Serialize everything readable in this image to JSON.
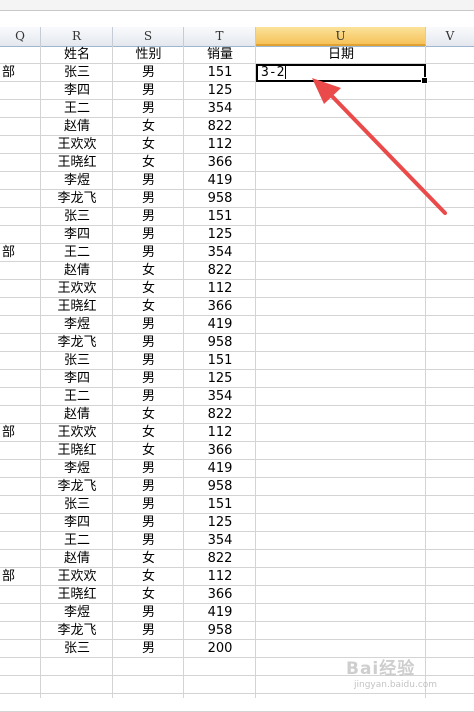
{
  "columns": [
    {
      "letter": "Q",
      "name": "col-q"
    },
    {
      "letter": "R",
      "name": "col-r"
    },
    {
      "letter": "S",
      "name": "col-s"
    },
    {
      "letter": "T",
      "name": "col-t"
    },
    {
      "letter": "U",
      "name": "col-u"
    },
    {
      "letter": "V",
      "name": "col-v"
    }
  ],
  "header_row": {
    "r": "姓名",
    "s": "性别",
    "t": "销量",
    "u": "日期"
  },
  "active_cell": {
    "column": "U",
    "input_text": "3-2"
  },
  "rows": [
    {
      "q": "部",
      "r": "张三",
      "s": "男",
      "t": "151"
    },
    {
      "q": "",
      "r": "李四",
      "s": "男",
      "t": "125"
    },
    {
      "q": "",
      "r": "王二",
      "s": "男",
      "t": "354"
    },
    {
      "q": "",
      "r": "赵倩",
      "s": "女",
      "t": "822"
    },
    {
      "q": "",
      "r": "王欢欢",
      "s": "女",
      "t": "112"
    },
    {
      "q": "",
      "r": "王晓红",
      "s": "女",
      "t": "366"
    },
    {
      "q": "",
      "r": "李煜",
      "s": "男",
      "t": "419"
    },
    {
      "q": "",
      "r": "李龙飞",
      "s": "男",
      "t": "958"
    },
    {
      "q": "",
      "r": "张三",
      "s": "男",
      "t": "151"
    },
    {
      "q": "",
      "r": "李四",
      "s": "男",
      "t": "125"
    },
    {
      "q": "部",
      "r": "王二",
      "s": "男",
      "t": "354"
    },
    {
      "q": "",
      "r": "赵倩",
      "s": "女",
      "t": "822"
    },
    {
      "q": "",
      "r": "王欢欢",
      "s": "女",
      "t": "112"
    },
    {
      "q": "",
      "r": "王晓红",
      "s": "女",
      "t": "366"
    },
    {
      "q": "",
      "r": "李煜",
      "s": "男",
      "t": "419"
    },
    {
      "q": "",
      "r": "李龙飞",
      "s": "男",
      "t": "958"
    },
    {
      "q": "",
      "r": "张三",
      "s": "男",
      "t": "151"
    },
    {
      "q": "",
      "r": "李四",
      "s": "男",
      "t": "125"
    },
    {
      "q": "",
      "r": "王二",
      "s": "男",
      "t": "354"
    },
    {
      "q": "",
      "r": "赵倩",
      "s": "女",
      "t": "822"
    },
    {
      "q": "部",
      "r": "王欢欢",
      "s": "女",
      "t": "112"
    },
    {
      "q": "",
      "r": "王晓红",
      "s": "女",
      "t": "366"
    },
    {
      "q": "",
      "r": "李煜",
      "s": "男",
      "t": "419"
    },
    {
      "q": "",
      "r": "李龙飞",
      "s": "男",
      "t": "958"
    },
    {
      "q": "",
      "r": "张三",
      "s": "男",
      "t": "151"
    },
    {
      "q": "",
      "r": "李四",
      "s": "男",
      "t": "125"
    },
    {
      "q": "",
      "r": "王二",
      "s": "男",
      "t": "354"
    },
    {
      "q": "",
      "r": "赵倩",
      "s": "女",
      "t": "822"
    },
    {
      "q": "部",
      "r": "王欢欢",
      "s": "女",
      "t": "112"
    },
    {
      "q": "",
      "r": "王晓红",
      "s": "女",
      "t": "366"
    },
    {
      "q": "",
      "r": "李煜",
      "s": "男",
      "t": "419"
    },
    {
      "q": "",
      "r": "李龙飞",
      "s": "男",
      "t": "958"
    },
    {
      "q": "",
      "r": "张三",
      "s": "男",
      "t": "200"
    },
    {
      "q": "",
      "r": "",
      "s": "",
      "t": ""
    },
    {
      "q": "",
      "r": "",
      "s": "",
      "t": ""
    },
    {
      "q": "",
      "r": "",
      "s": "",
      "t": ""
    }
  ],
  "colors": {
    "active_header": "#f6c25a",
    "arrow": "#ea4a4a",
    "grid_line": "#d4d4d4"
  },
  "watermark": {
    "text": "Bai经验",
    "sub": "jingyan.baidu.com"
  }
}
